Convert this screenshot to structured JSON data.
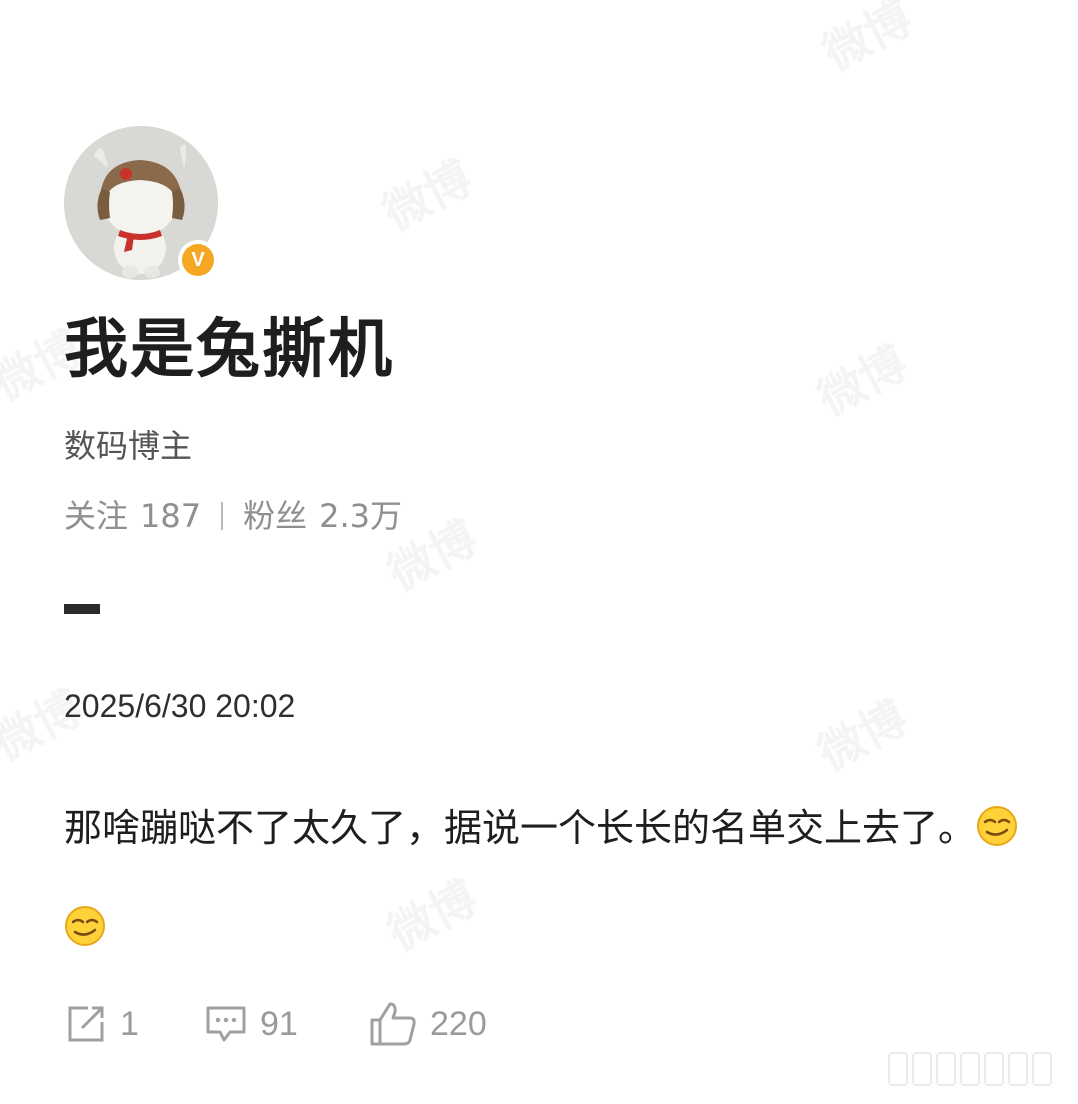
{
  "profile": {
    "name": "我是兔撕机",
    "role": "数码博主",
    "follow_label": "关注",
    "follow_count": "187",
    "fans_label": "粉丝",
    "fans_count": "2.3万",
    "verified_badge": "V"
  },
  "post": {
    "timestamp": "2025/6/30 20:02",
    "text": "那啥蹦哒不了太久了，据说一个长长的名单交上去了。",
    "emojis": [
      "smirk-emoji",
      "smirk-emoji"
    ]
  },
  "actions": {
    "repost_count": "1",
    "comment_count": "91",
    "like_count": "220"
  },
  "watermark_text": "微博",
  "colors": {
    "badge": "#f5a623",
    "muted": "#8f8f8f",
    "text": "#1e1e1e"
  }
}
